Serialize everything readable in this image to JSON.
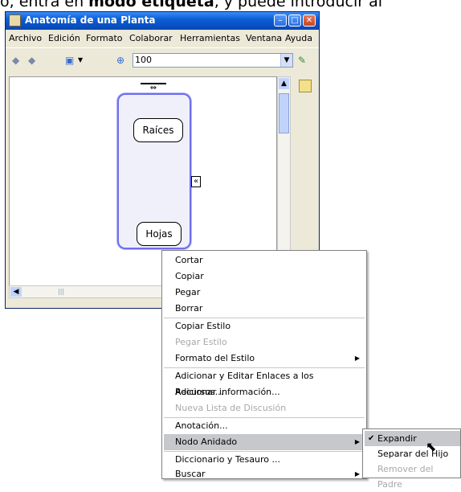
{
  "caption": {
    "before": "o, entra en ",
    "bold": "modo etiqueta",
    "after": ", y puede introducir al"
  },
  "window": {
    "title": "Anatomía de una Planta",
    "buttons": [
      "minimize",
      "maximize",
      "close"
    ]
  },
  "menubar": {
    "items": [
      "Archivo",
      "Edición",
      "Formato",
      "Colaborar",
      "Herramientas",
      "Ventana",
      "Ayuda"
    ]
  },
  "toolbar": {
    "zoom_value": "100",
    "icons": [
      "back-arrow-icon",
      "forward-arrow-icon",
      "view-mode-icon",
      "zoom-icon",
      "info-icon"
    ]
  },
  "map": {
    "nodes": [
      "Raíces",
      "Hojas"
    ]
  },
  "context_menu": {
    "items": [
      {
        "label": "Cortar",
        "disabled": false
      },
      {
        "label": "Copiar",
        "disabled": false
      },
      {
        "label": "Pegar",
        "disabled": false
      },
      {
        "label": "Borrar",
        "disabled": false
      },
      {
        "label": "Copiar Estilo",
        "disabled": false
      },
      {
        "label": "Pegar Estilo",
        "disabled": true
      },
      {
        "label": "Formato del Estilo",
        "disabled": false,
        "submenu": true
      },
      {
        "label": "Adicionar y Editar Enlaces a los Recursos...",
        "disabled": false
      },
      {
        "label": "Adicionar información...",
        "disabled": false
      },
      {
        "label": "Nueva Lista de Discusión",
        "disabled": true
      },
      {
        "label": "Anotación...",
        "disabled": false
      },
      {
        "label": "Nodo Anidado",
        "disabled": false,
        "submenu": true,
        "highlighted": true
      },
      {
        "label": "Diccionario y Tesauro ...",
        "disabled": false
      },
      {
        "label": "Buscar",
        "disabled": false,
        "submenu": true
      }
    ]
  },
  "submenu": {
    "items": [
      {
        "label": "Expandir",
        "checked": true,
        "highlighted": true
      },
      {
        "label": "Separar del Hijo",
        "checked": false
      },
      {
        "label": "Remover del Padre",
        "checked": false,
        "disabled": true
      }
    ]
  }
}
